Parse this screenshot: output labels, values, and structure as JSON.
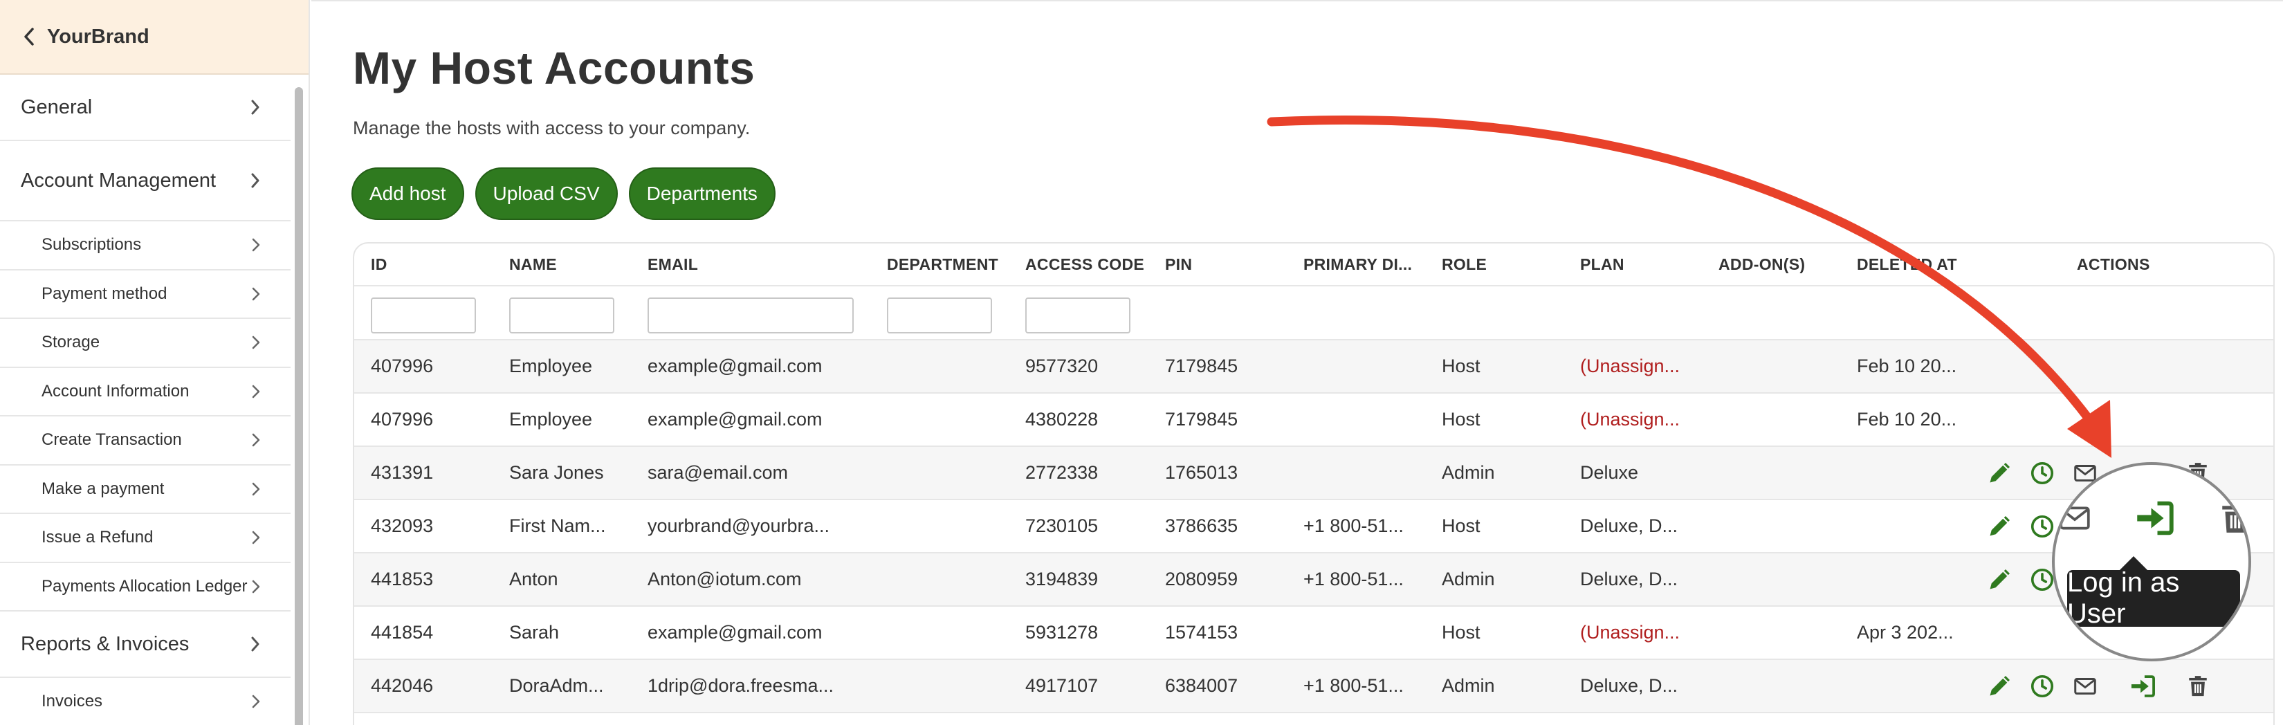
{
  "colors": {
    "accent_green": "#2f7a1f",
    "unassigned_red": "#b01e1e",
    "brand_bg": "#fdf0e0",
    "arrow_red": "#e8412a"
  },
  "sidebar": {
    "brand": "YourBrand",
    "items": [
      {
        "label": "General",
        "level": "top"
      },
      {
        "label": "Account Management",
        "level": "top"
      },
      {
        "label": "Subscriptions",
        "level": "sub"
      },
      {
        "label": "Payment method",
        "level": "sub"
      },
      {
        "label": "Storage",
        "level": "sub"
      },
      {
        "label": "Account Information",
        "level": "sub"
      },
      {
        "label": "Create Transaction",
        "level": "sub"
      },
      {
        "label": "Make a payment",
        "level": "sub"
      },
      {
        "label": "Issue a Refund",
        "level": "sub"
      },
      {
        "label": "Payments Allocation Ledger",
        "level": "sub"
      },
      {
        "label": "Reports & Invoices",
        "level": "top"
      },
      {
        "label": "Invoices",
        "level": "sub"
      }
    ]
  },
  "page": {
    "title": "My Host Accounts",
    "subtitle": "Manage the hosts with access to your company."
  },
  "buttons": {
    "add_host": "Add host",
    "upload_csv": "Upload CSV",
    "departments": "Departments"
  },
  "table": {
    "columns": [
      "ID",
      "NAME",
      "EMAIL",
      "DEPARTMENT",
      "ACCESS CODE",
      "PIN",
      "PRIMARY DI...",
      "ROLE",
      "PLAN",
      "ADD-ON(S)",
      "DELETED AT",
      "ACTIONS"
    ],
    "rows": [
      {
        "id": "407996",
        "name": "Employee",
        "email": "example@gmail.com",
        "department": "",
        "access_code": "9577320",
        "pin": "7179845",
        "primary": "",
        "role": "Host",
        "plan": "(Unassign...",
        "addons": "",
        "deleted_at": "Feb 10 20..."
      },
      {
        "id": "407996",
        "name": "Employee",
        "email": "example@gmail.com",
        "department": "",
        "access_code": "4380228",
        "pin": "7179845",
        "primary": "",
        "role": "Host",
        "plan": "(Unassign...",
        "addons": "",
        "deleted_at": "Feb 10 20..."
      },
      {
        "id": "431391",
        "name": "Sara Jones",
        "email": "sara@email.com",
        "department": "",
        "access_code": "2772338",
        "pin": "1765013",
        "primary": "",
        "role": "Admin",
        "plan": "Deluxe",
        "addons": "",
        "deleted_at": ""
      },
      {
        "id": "432093",
        "name": "First Nam...",
        "email": "yourbrand@yourbra...",
        "department": "",
        "access_code": "7230105",
        "pin": "3786635",
        "primary": "+1 800-51...",
        "role": "Host",
        "plan": "Deluxe, D...",
        "addons": "",
        "deleted_at": ""
      },
      {
        "id": "441853",
        "name": "Anton",
        "email": "Anton@iotum.com",
        "department": "",
        "access_code": "3194839",
        "pin": "2080959",
        "primary": "+1 800-51...",
        "role": "Admin",
        "plan": "Deluxe, D...",
        "addons": "",
        "deleted_at": ""
      },
      {
        "id": "441854",
        "name": "Sarah",
        "email": "example@gmail.com",
        "department": "",
        "access_code": "5931278",
        "pin": "1574153",
        "primary": "",
        "role": "Host",
        "plan": "(Unassign...",
        "addons": "",
        "deleted_at": "Apr 3 202..."
      },
      {
        "id": "442046",
        "name": "DoraAdm...",
        "email": "1drip@dora.freesma...",
        "department": "",
        "access_code": "4917107",
        "pin": "6384007",
        "primary": "+1 800-51...",
        "role": "Admin",
        "plan": "Deluxe, D...",
        "addons": "",
        "deleted_at": ""
      }
    ]
  },
  "tooltip": "Log in as User"
}
